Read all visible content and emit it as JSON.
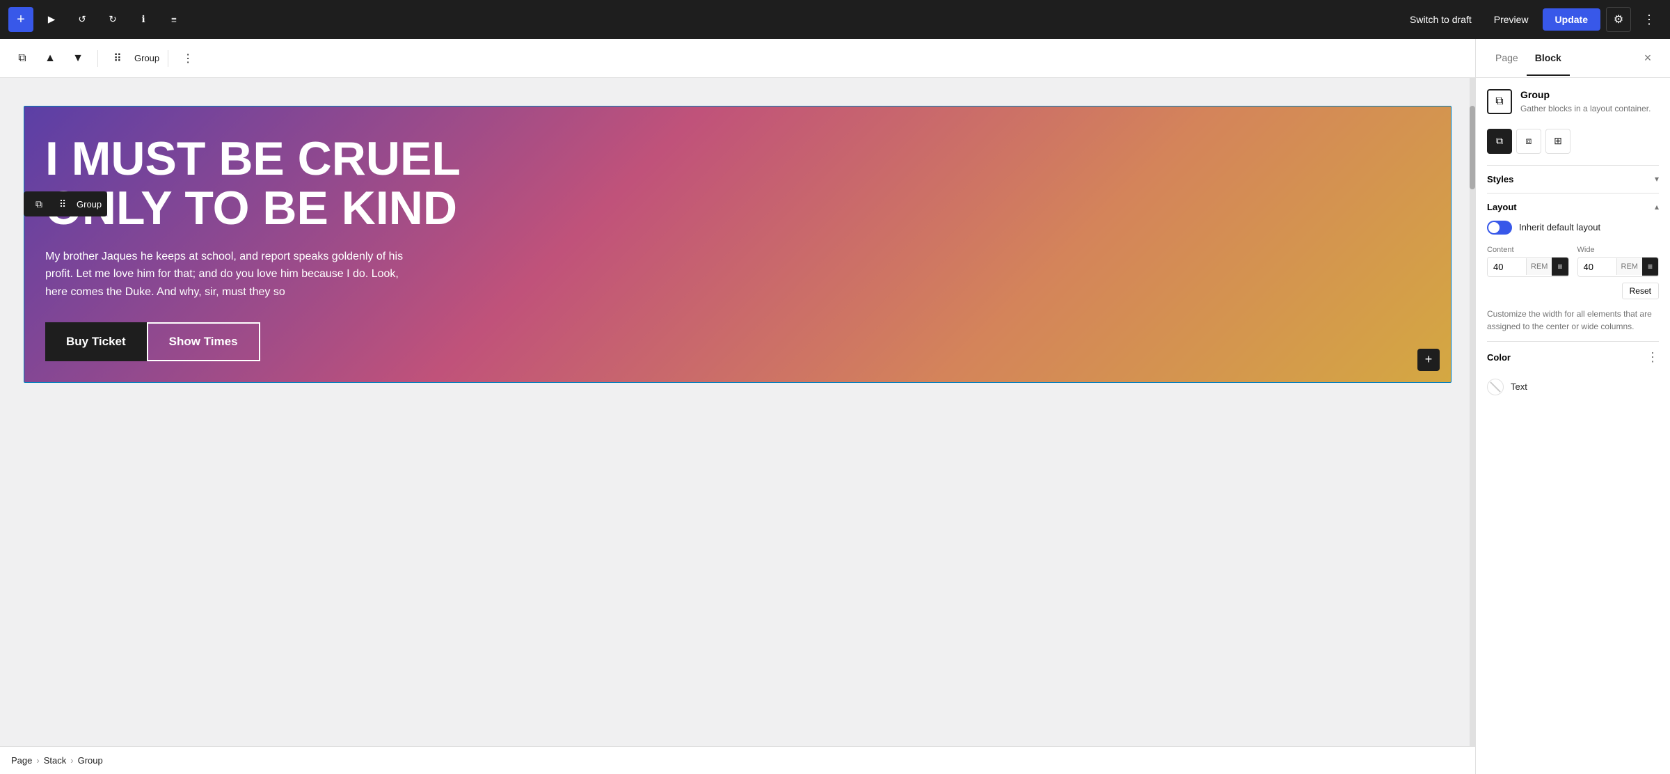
{
  "toolbar": {
    "add_icon": "+",
    "play_icon": "▶",
    "undo_icon": "↺",
    "redo_icon": "↻",
    "info_icon": "ℹ",
    "menu_icon": "≡",
    "switch_to_draft_label": "Switch to draft",
    "preview_label": "Preview",
    "update_label": "Update",
    "settings_icon": "⚙",
    "more_icon": "⋮"
  },
  "secondary_toolbar": {
    "copy_icon": "⧉",
    "drag_icon": "⠿",
    "group_label": "Group",
    "more_icon": "⋮"
  },
  "hero": {
    "title": "I MUST BE CRUEL ONLY TO BE KIND",
    "description": "My brother Jaques he keeps at school, and report speaks goldenly of his profit. Let me love him for that; and do you love him because I do. Look, here comes the Duke. And why, sir, must they so",
    "btn_buy_label": "Buy Ticket",
    "btn_show_label": "Show Times",
    "add_icon": "+"
  },
  "group_block_toolbar": {
    "copy_icon": "⧉",
    "drag_icon": "⠿",
    "label": "Group"
  },
  "breadcrumb": {
    "items": [
      "Page",
      "Stack",
      "Group"
    ],
    "separator": "›"
  },
  "right_panel": {
    "tab_page_label": "Page",
    "tab_block_label": "Block",
    "close_icon": "×",
    "active_tab": "Block",
    "block_icon": "⧉",
    "block_title": "Group",
    "block_description": "Gather blocks in a layout container.",
    "layout_icons": {
      "icon1": "⧉",
      "icon2": "⧈",
      "icon3": "⊞"
    },
    "styles_label": "Styles",
    "layout_label": "Layout",
    "inherit_default_layout": "Inherit default layout",
    "content_label": "Content",
    "content_value": "40",
    "content_unit": "REM",
    "wide_label": "Wide",
    "wide_value": "40",
    "wide_unit": "REM",
    "reset_label": "Reset",
    "customize_text": "Customize the width for all elements that are assigned to the center or wide columns.",
    "color_label": "Color",
    "color_more_icon": "⋮",
    "text_color_label": "Text"
  }
}
